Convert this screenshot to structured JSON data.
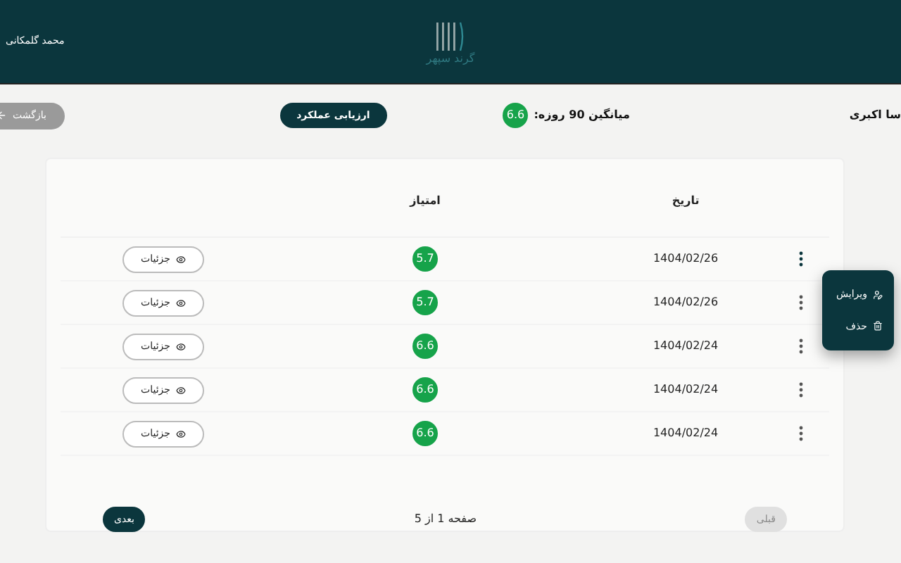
{
  "header": {
    "user_name": "محمد گلمکانی",
    "logo_text": "گرند سپهر"
  },
  "toolbar": {
    "person_name": "سا اکبری",
    "average_label": "میانگین 90 روزه:",
    "average_score": "6.6",
    "evaluate_button": "ارزیابی عملکرد",
    "back_button": "بازگشت"
  },
  "table": {
    "columns": [
      "تاریخ",
      "امتیاز"
    ],
    "rows": [
      {
        "date": "1404/02/26",
        "score": "5.7",
        "details": "جزئیات",
        "menu_open": true
      },
      {
        "date": "1404/02/26",
        "score": "5.7",
        "details": "جزئیات",
        "menu_open": false
      },
      {
        "date": "1404/02/24",
        "score": "6.6",
        "details": "جزئیات",
        "menu_open": false
      },
      {
        "date": "1404/02/24",
        "score": "6.6",
        "details": "جزئیات",
        "menu_open": false
      },
      {
        "date": "1404/02/24",
        "score": "6.6",
        "details": "جزئیات",
        "menu_open": false
      }
    ]
  },
  "row_menu": [
    {
      "kind": "edit",
      "label": "ویرایش"
    },
    {
      "kind": "delete",
      "label": "حذف"
    }
  ],
  "pagination": {
    "previous": {
      "label": "قبلی",
      "disabled": true
    },
    "page_info": "صفحه 1 از 5",
    "next": {
      "label": "بعدی",
      "disabled": false
    }
  }
}
